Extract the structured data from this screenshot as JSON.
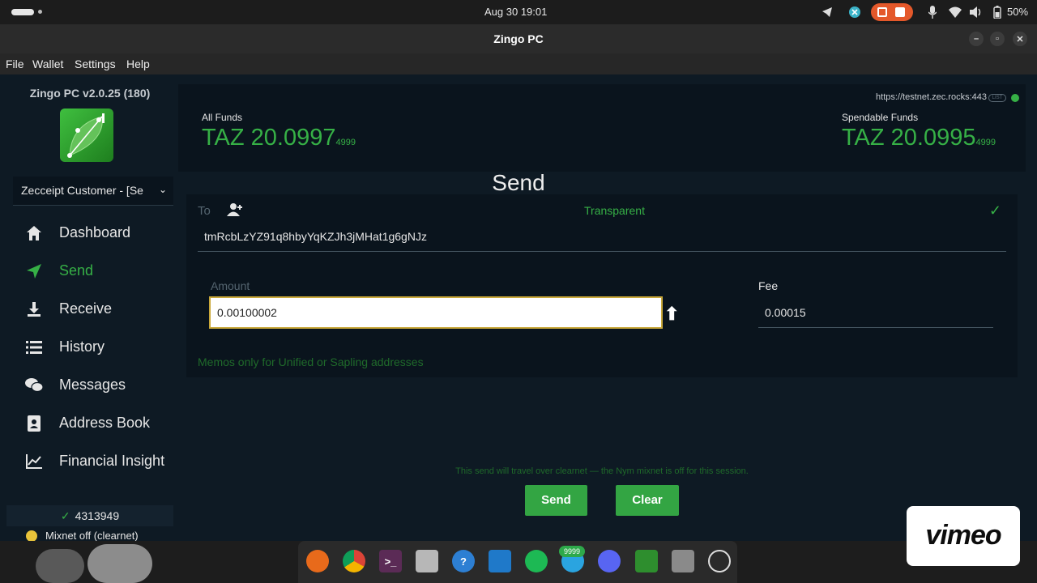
{
  "system": {
    "clock": "Aug 30  19:01",
    "battery": "50%"
  },
  "window": {
    "title": "Zingo PC"
  },
  "menu": [
    "File",
    "Wallet",
    "Settings",
    "Help"
  ],
  "sidebar": {
    "version": "Zingo PC v2.0.25 (180)",
    "wallet_selector": "Zecceipt Customer - [Se",
    "items": [
      {
        "label": "Dashboard",
        "icon": "home-icon"
      },
      {
        "label": "Send",
        "icon": "send-icon",
        "active": true
      },
      {
        "label": "Receive",
        "icon": "download-icon"
      },
      {
        "label": "History",
        "icon": "list-icon"
      },
      {
        "label": "Messages",
        "icon": "chat-icon"
      },
      {
        "label": "Address Book",
        "icon": "contact-book-icon"
      },
      {
        "label": "Financial Insight",
        "icon": "chart-icon"
      }
    ],
    "sync_height": "4313949",
    "mixnet_status": "Mixnet off (clearnet)"
  },
  "balance": {
    "server": "https://testnet.zec.rocks:443",
    "server_tag": "LIST",
    "all_funds_label": "All Funds",
    "all_funds_value": "TAZ 20.0997",
    "all_funds_small": "4999",
    "spendable_label": "Spendable Funds",
    "spendable_value": "TAZ 20.0995",
    "spendable_small": "4999"
  },
  "send": {
    "title": "Send",
    "to_label": "To",
    "address_type": "Transparent",
    "address": "tmRcbLzYZ91q8hbyYqKZJh3jMHat1g6gNJz",
    "amount_label": "Amount",
    "amount_value": "0.00100002",
    "fee_label": "Fee",
    "fee_value": "0.00015",
    "memo_note": "Memos only for Unified or Sapling addresses",
    "clearnet_note": "This send will travel over clearnet — the Nym mixnet is off for this session.",
    "send_button": "Send",
    "clear_button": "Clear"
  },
  "dock": {
    "badge": "9999"
  },
  "overlay": {
    "watermark": "vimeo"
  },
  "colors": {
    "accent_green": "#36b046",
    "background": "#0e1a24",
    "panel": "#0a141d"
  }
}
